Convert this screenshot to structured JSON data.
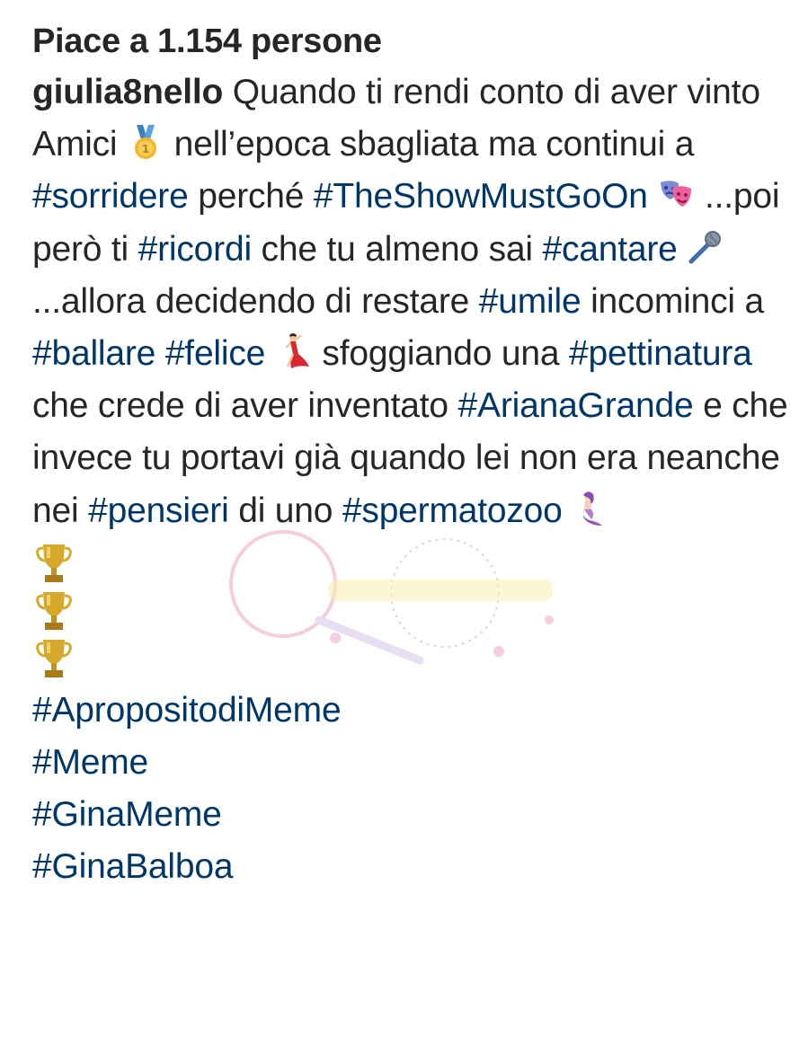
{
  "post": {
    "likes_label": "Piace a 1.154 persone",
    "username": "giulia8nello",
    "caption": {
      "t1": " Quando ti rendi conto di aver vinto Amici ",
      "t2": " nell’epoca sbagliata ma continui a ",
      "tag_sorridere": "#sorridere",
      "t3": " perché ",
      "tag_showmustgoon": "#TheShowMustGoOn",
      "t4": " ...poi però ti ",
      "tag_ricordi": "#ricordi",
      "t5": " che tu almeno sai ",
      "tag_cantare": "#cantare",
      "t6": " ...allora decidendo di restare ",
      "tag_umile": "#umile",
      "t7": " incominci a ",
      "tag_ballare": "#ballare",
      "tag_felice": "#felice",
      "t8": " sfoggiando una ",
      "tag_pettinatura": "#pettinatura",
      "t9": " che crede di aver inventato ",
      "tag_ariana": "#ArianaGrande",
      "t10": " e che invece tu portavi già quando lei non era neanche nei ",
      "tag_pensieri": "#pensieri",
      "t11": " di uno ",
      "tag_spermatozoo": "#spermatozoo"
    },
    "hashtags": [
      "#ApropositodiMeme",
      "#Meme",
      "#GinaMeme",
      "#GinaBalboa"
    ],
    "emoji": {
      "medal": "gold-medal-icon",
      "masks": "theater-masks-icon",
      "mic": "microphone-icon",
      "dancer": "dancer-icon",
      "mermaid": "mermaid-icon",
      "trophy": "trophy-icon"
    }
  },
  "colors": {
    "text": "#262626",
    "hashtag": "#00376b",
    "background": "#ffffff"
  }
}
